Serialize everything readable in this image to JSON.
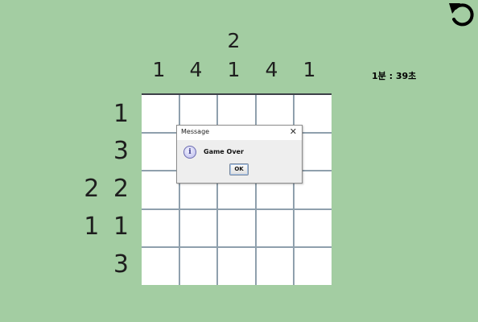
{
  "undo_icon": "undo-arrow-icon",
  "timer": "1분 : 39초",
  "column_clues": [
    [
      "1"
    ],
    [
      "4"
    ],
    [
      "2",
      "1"
    ],
    [
      "4"
    ],
    [
      "1"
    ]
  ],
  "row_clues": [
    "1",
    "3",
    "2 2",
    "1 1",
    "3"
  ],
  "grid": {
    "rows": 5,
    "cols": 5
  },
  "dialog": {
    "title": "Message",
    "close": "✕",
    "icon": "info-icon",
    "icon_glyph": "i",
    "message": "Game Over",
    "ok_label": "OK"
  },
  "colors": {
    "background": "#a3cda2",
    "cell": "#ffffff",
    "grid_line": "#8fa0ad"
  }
}
